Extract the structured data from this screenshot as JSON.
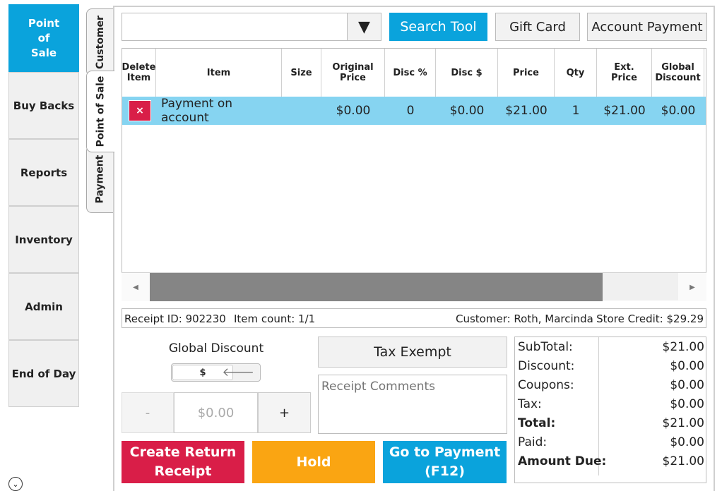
{
  "nav": {
    "items": [
      {
        "label": "Point\nof\nSale",
        "active": true
      },
      {
        "label": "Buy Backs"
      },
      {
        "label": "Reports"
      },
      {
        "label": "Inventory"
      },
      {
        "label": "Admin"
      },
      {
        "label": "End of Day"
      }
    ],
    "bottom_icon": "chevron-down-circle-icon",
    "bottom_glyph": "⌄"
  },
  "tabs": [
    "Customer",
    "Point of Sale",
    "Payment"
  ],
  "selected_tab": "Point of Sale",
  "toolbar": {
    "search_value": "",
    "dropdown_glyph": "▼",
    "search_tool": "Search Tool",
    "gift_card": "Gift Card",
    "account_payment": "Account Payment"
  },
  "table": {
    "headers": [
      "Delete\nItem",
      "Item",
      "Size",
      "Original\nPrice",
      "Disc %",
      "Disc $",
      "Price",
      "Qty",
      "Ext.\nPrice",
      "Global\nDiscount"
    ],
    "rows": [
      {
        "delete_glyph": "×",
        "item": "Payment on account",
        "size": "",
        "original_price": "$0.00",
        "disc_pct": "0",
        "disc_amt": "$0.00",
        "price": "$21.00",
        "qty": "1",
        "ext_price": "$21.00",
        "global_discount": "$0.00"
      }
    ],
    "scroll_left": "◀",
    "scroll_right": "▶"
  },
  "info": {
    "receipt": "Receipt ID: 902230",
    "item_count": "Item count: 1/1",
    "customer": "Customer: Roth, Marcinda",
    "store_credit": "Store Credit: $29.29"
  },
  "discount": {
    "label": "Global Discount",
    "mode": "$",
    "arrow": "🡐",
    "minus": "-",
    "value": "$0.00",
    "plus": "+"
  },
  "tax_exempt": "Tax Exempt",
  "comments_placeholder": "Receipt Comments",
  "actions": {
    "create_return": "Create Return\nReceipt",
    "hold": "Hold",
    "go_to_payment": "Go to Payment\n(F12)"
  },
  "totals": [
    {
      "label": "SubTotal:",
      "value": "$21.00",
      "bold": false
    },
    {
      "label": "Discount:",
      "value": "$0.00",
      "bold": false
    },
    {
      "label": "Coupons:",
      "value": "$0.00",
      "bold": false
    },
    {
      "label": "Tax:",
      "value": "$0.00",
      "bold": false
    },
    {
      "label": "Total:",
      "value": "$21.00",
      "bold": true
    },
    {
      "label": "Paid:",
      "value": "$0.00",
      "bold": false
    },
    {
      "label": "Amount Due:",
      "value": "$21.00",
      "bold": true
    }
  ],
  "colors": {
    "accent_blue": "#0aa3dc",
    "row_highlight": "#86d4f1",
    "return_red": "#d91e48",
    "hold_orange": "#faa512",
    "payment_blue": "#0aa3dc"
  }
}
